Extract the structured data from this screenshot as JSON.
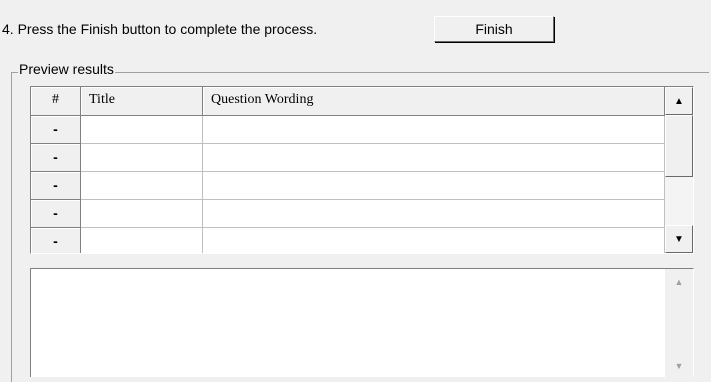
{
  "step": {
    "text": "4.  Press the Finish button to complete the process.",
    "finish_label": "Finish"
  },
  "preview": {
    "legend": "Preview results",
    "columns": [
      "#",
      "Title",
      "Question Wording"
    ],
    "rows": [
      {
        "num": "-",
        "title": "",
        "wording": ""
      },
      {
        "num": "-",
        "title": "",
        "wording": ""
      },
      {
        "num": "-",
        "title": "",
        "wording": ""
      },
      {
        "num": "-",
        "title": "",
        "wording": ""
      },
      {
        "num": "-",
        "title": "",
        "wording": ""
      }
    ]
  },
  "icons": {
    "scroll_up": "scroll-up-arrow-icon",
    "scroll_down": "scroll-down-arrow-icon"
  },
  "details": {
    "text": ""
  }
}
